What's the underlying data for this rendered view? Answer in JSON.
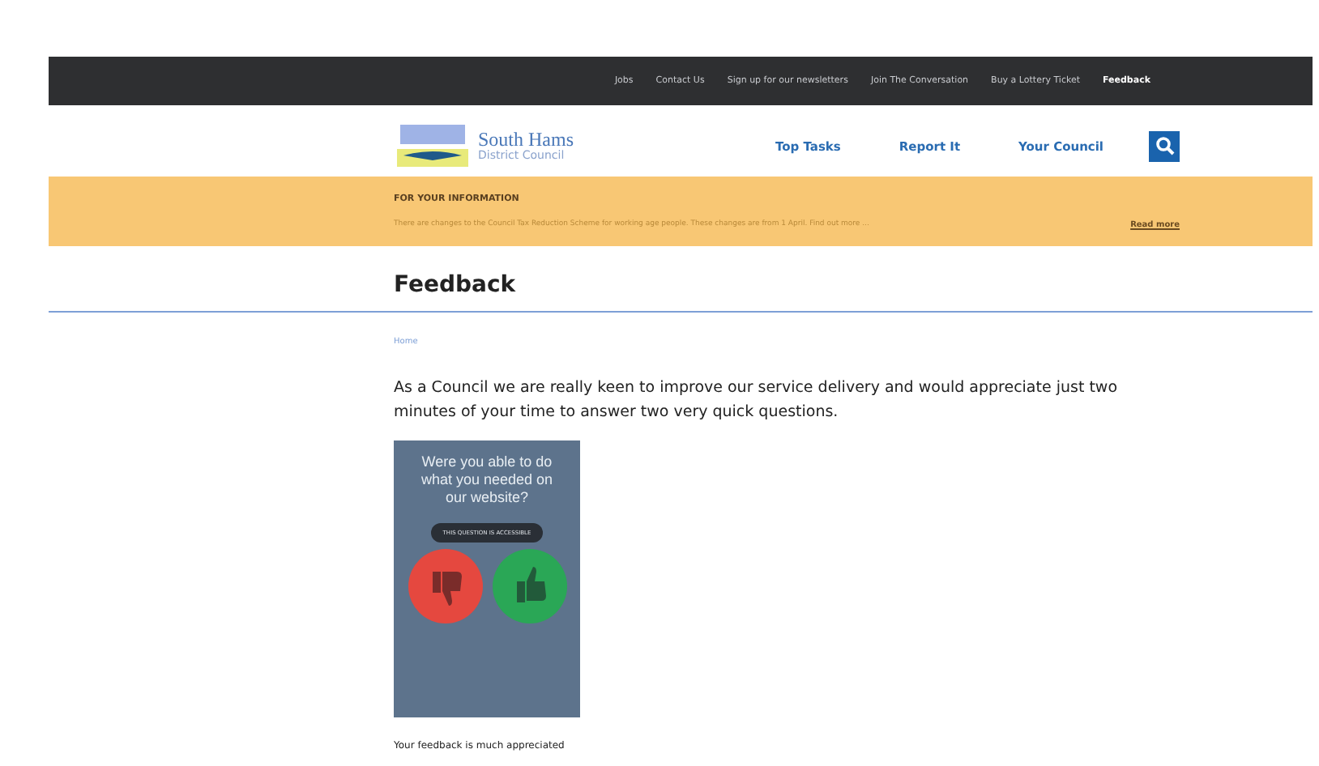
{
  "top_links": [
    {
      "label": "Jobs",
      "selected": false
    },
    {
      "label": "Contact Us",
      "selected": false
    },
    {
      "label": "Sign up for our newsletters",
      "selected": false
    },
    {
      "label": "Join The Conversation",
      "selected": false
    },
    {
      "label": "Buy a Lottery Ticket",
      "selected": false
    },
    {
      "label": "Feedback",
      "selected": true
    }
  ],
  "logo": {
    "name": "South Hams",
    "subtitle": "District Council"
  },
  "main_nav": [
    "Top Tasks",
    "Report It",
    "Your Council"
  ],
  "notice": {
    "heading": "FOR YOUR INFORMATION",
    "text": "There are changes to the Council Tax Reduction Scheme for working age people. These changes are from 1 April. Find out more ...",
    "link": "Read more"
  },
  "page_title": "Feedback",
  "breadcrumb": [
    "Home"
  ],
  "intro": "As a Council we are really keen to improve our service delivery and would appreciate just two minutes of your time to answer two very quick questions.",
  "survey_card": {
    "question": "Were you able to do what you needed on our website?",
    "pill": "THIS QUESTION IS ACCESSIBLE"
  },
  "caption": "Your feedback is much appreciated"
}
